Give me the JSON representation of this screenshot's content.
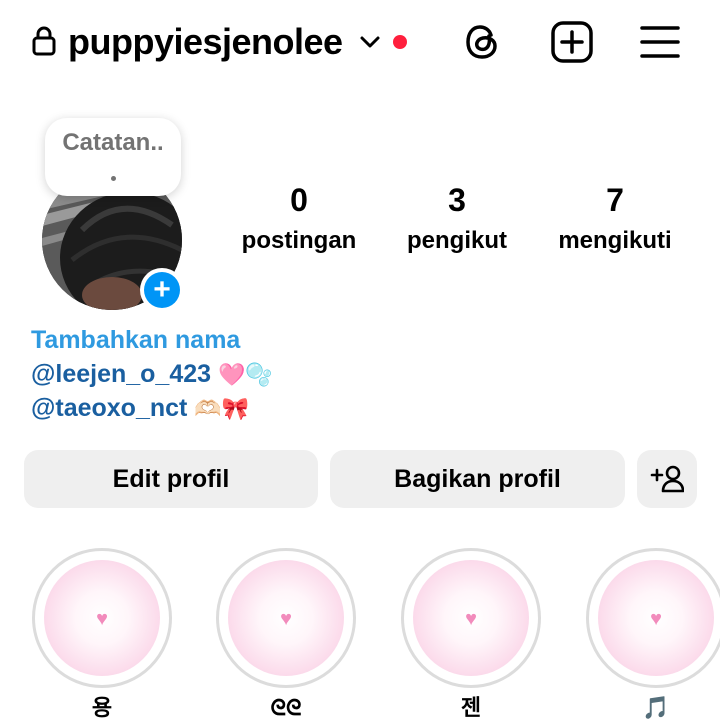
{
  "header": {
    "username": "puppyiesjenolee",
    "icons": {
      "lock": "lock-icon",
      "chevron": "chevron-down-icon",
      "threads": "threads-icon",
      "create": "plus-square-icon",
      "menu": "hamburger-menu-icon"
    },
    "notification_dot_color": "#ff1f3d"
  },
  "profile": {
    "note": "Catatan..",
    "stats": [
      {
        "value": "0",
        "label": "postingan"
      },
      {
        "value": "3",
        "label": "pengikut"
      },
      {
        "value": "7",
        "label": "mengikuti"
      }
    ],
    "add_name": "Tambahkan nama",
    "bio": [
      {
        "handle": "@leejen_o_423",
        "emoji": "🩷🫧"
      },
      {
        "handle": "@taeoxo_nct",
        "emoji": "🫶🏻🎀"
      }
    ],
    "accent_color": "#0095f6"
  },
  "actions": {
    "edit_label": "Edit profil",
    "share_label": "Bagikan profil",
    "add_user_icon": "add-user-icon"
  },
  "highlights": [
    {
      "label": "용"
    },
    {
      "label": "ᘓᘓ"
    },
    {
      "label": "젠"
    },
    {
      "label": "🎵"
    }
  ]
}
